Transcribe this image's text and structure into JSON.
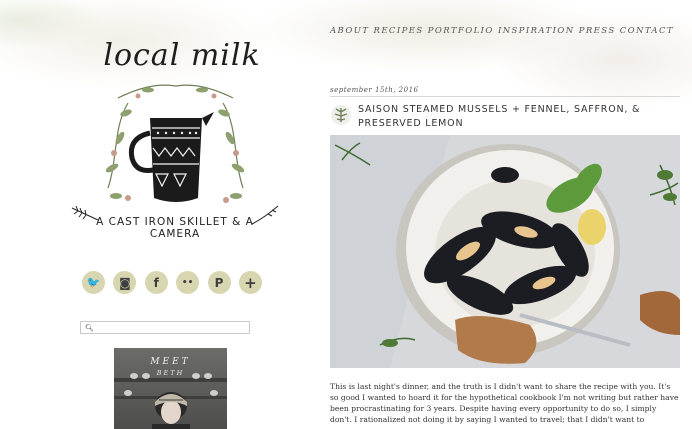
{
  "nav": {
    "items": [
      "ABOUT",
      "RECIPES",
      "PORTFOLIO",
      "INSPIRATION",
      "PRESS",
      "CONTACT"
    ]
  },
  "logo": {
    "title": "local milk",
    "tagline": "A CAST IRON SKILLET & A CAMERA"
  },
  "social": {
    "items": [
      {
        "name": "twitter",
        "glyph": "🐦"
      },
      {
        "name": "instagram",
        "glyph": "◙"
      },
      {
        "name": "facebook",
        "glyph": "f"
      },
      {
        "name": "flickr",
        "glyph": "••"
      },
      {
        "name": "pinterest",
        "glyph": "P"
      },
      {
        "name": "plus",
        "glyph": "+"
      }
    ]
  },
  "search": {
    "placeholder": ""
  },
  "sidebar": {
    "meet_title": "MEET",
    "meet_name": "BETH"
  },
  "post": {
    "date": "september 15th, 2016",
    "title": "SAISON STEAMED MUSSELS + FENNEL, SAFFRON, & PRESERVED LEMON",
    "body": "This is last night's dinner, and the truth is I didn't want to share the recipe with you. It's so good I wanted to hoard it for the hypothetical cookbook I'm not writing but rather have been procrastinating for 3 years. Despite having every opportunity to do so, I simply don't. I rationalized not doing it by saying I wanted to travel; that I didn't want to"
  },
  "colors": {
    "social_bg": "#d7d6b0",
    "wash": "#e6e2d2",
    "text": "#333333"
  }
}
